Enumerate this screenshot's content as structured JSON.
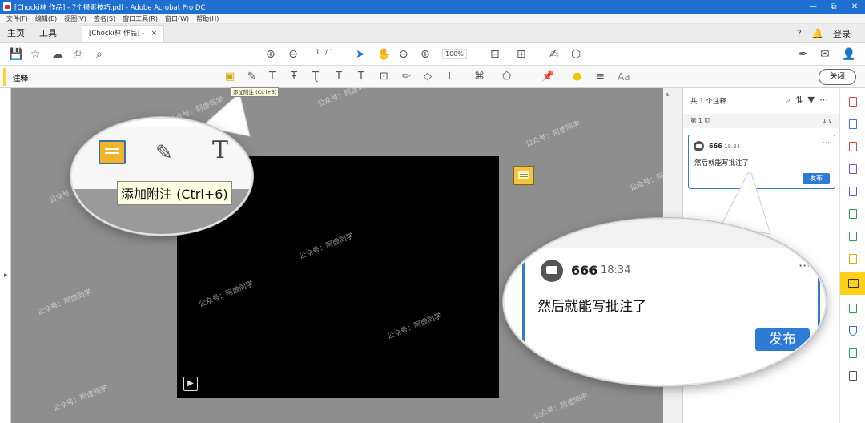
{
  "titlebar": {
    "title": "[Chocki林 作品] - 7个摄影技巧.pdf - Adobe Acrobat Pro DC",
    "minimize": "—",
    "restore": "⧉",
    "close": "✕"
  },
  "menubar": {
    "items": [
      "文件(F)",
      "编辑(E)",
      "视图(V)",
      "签名(S)",
      "窗口工具(R)",
      "窗口(W)",
      "帮助(H)"
    ]
  },
  "tabs": {
    "home": "主页",
    "tools": "工具",
    "document": "[Chocki林 作品] - 7...",
    "document_close": "×",
    "help_icon": "?",
    "bell_icon": "🔔",
    "login": "登录"
  },
  "toolbar": {
    "page_current": "1",
    "page_total": "/ 1",
    "zoom": "100%"
  },
  "commentbar": {
    "label": "注释",
    "close_button": "关闭",
    "tooltip": "添加附注 (Ctrl+6)",
    "text_tool": "Aa"
  },
  "magnifier_tools": {
    "tooltip": "添加附注 (Ctrl+6)",
    "text_glyph": "T"
  },
  "panel": {
    "header": "共 1 个注释",
    "page_label": "第 1 页",
    "page_count": "1 ∨",
    "comment": {
      "user": "666",
      "time": "18:34",
      "text": "然后就能写批注了",
      "publish": "发布",
      "more": "···"
    }
  },
  "watermark": "公众号：阿虚同学",
  "colors": {
    "titlebar": "#1e6fd0",
    "accent_blue": "#2d7bd4",
    "sticky_yellow": "#f7c33a",
    "rail_active": "#ffd11a"
  }
}
